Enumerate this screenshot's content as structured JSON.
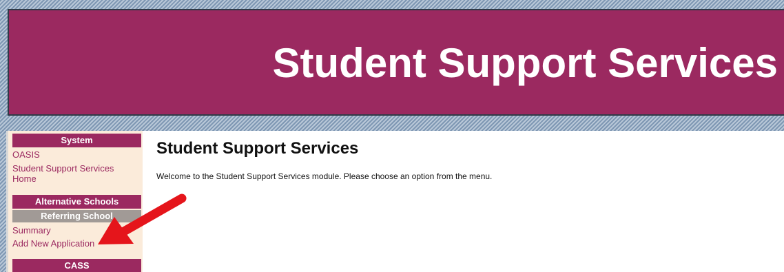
{
  "header": {
    "title": "Student Support Services"
  },
  "sidebar": {
    "system": {
      "heading": "System",
      "links": [
        "OASIS",
        "Student Support Services Home"
      ]
    },
    "alternative_schools": {
      "heading": "Alternative Schools",
      "subheading": "Referring School",
      "links": [
        "Summary",
        "Add New Application"
      ]
    },
    "cass": {
      "heading": "CASS"
    }
  },
  "main": {
    "title": "Student Support Services",
    "welcome": "Welcome to the Student Support Services module. Please choose an option from the menu."
  },
  "colors": {
    "brand": "#9b2960",
    "subheader": "#a19a96",
    "sidebar_bg": "#fbebda",
    "annotation_arrow": "#e5151b"
  },
  "annotation": {
    "icon": "red-arrow-icon"
  }
}
